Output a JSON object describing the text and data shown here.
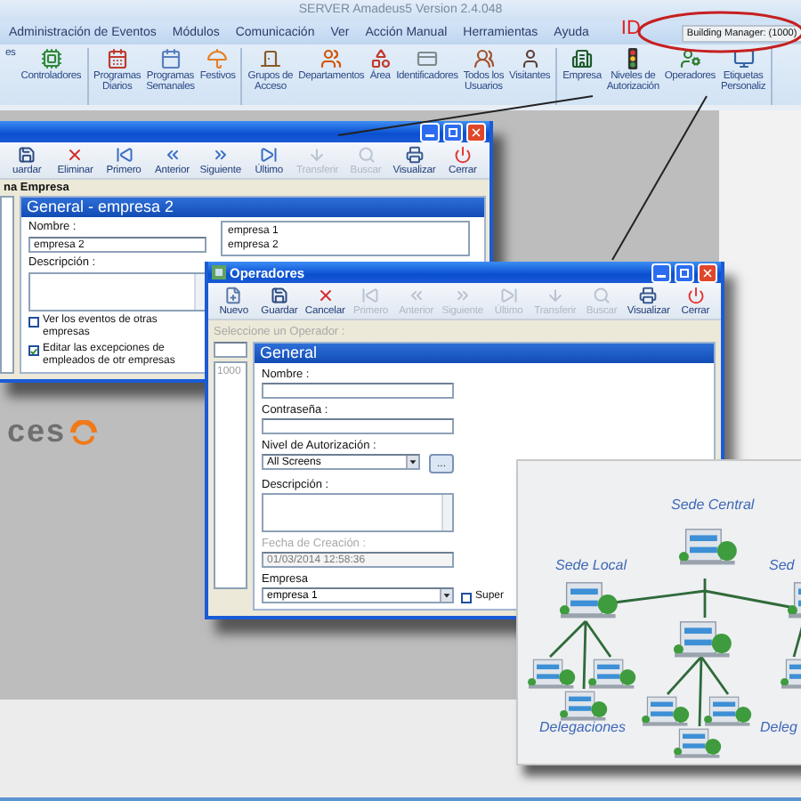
{
  "app": {
    "title": "SERVER Amadeus5 Version 2.4.048"
  },
  "menu": [
    "Administración de Eventos",
    "Módulos",
    "Comunicación",
    "Ver",
    "Acción Manual",
    "Herramientas",
    "Ayuda"
  ],
  "callout": {
    "label": "ID",
    "user": "Building Manager: (1000)"
  },
  "toolbar": [
    {
      "items": [
        {
          "kind": "cut",
          "label": "es"
        },
        {
          "kind": "controllers",
          "label": "Controladores"
        }
      ]
    },
    {
      "items": [
        {
          "kind": "daily",
          "label": "Programas\nDiarios"
        },
        {
          "kind": "weekly",
          "label": "Programas\nSemanales"
        },
        {
          "kind": "holidays",
          "label": "Festivos"
        }
      ]
    },
    {
      "items": [
        {
          "kind": "groups",
          "label": "Grupos de\nAcceso"
        },
        {
          "kind": "departments",
          "label": "Departamentos"
        },
        {
          "kind": "area",
          "label": "Área"
        },
        {
          "kind": "ids",
          "label": "Identificadores"
        },
        {
          "kind": "users",
          "label": "Todos los\nUsuarios"
        },
        {
          "kind": "visitors",
          "label": "Visitantes"
        }
      ]
    },
    {
      "items": [
        {
          "kind": "company",
          "label": "Empresa"
        },
        {
          "kind": "levels",
          "label": "Niveles de\nAutorización"
        },
        {
          "kind": "operators",
          "label": "Operadores"
        },
        {
          "kind": "labels",
          "label": "Etiquetas\nPersonaliz"
        }
      ]
    }
  ],
  "empresa_window": {
    "toolbar": [
      {
        "kind": "save",
        "label": "uardar",
        "disabled": false
      },
      {
        "kind": "delete",
        "label": "Eliminar",
        "disabled": false
      },
      {
        "kind": "first",
        "label": "Primero",
        "disabled": false
      },
      {
        "kind": "previous",
        "label": "Anterior",
        "disabled": false
      },
      {
        "kind": "next",
        "label": "Siguiente",
        "disabled": false
      },
      {
        "kind": "last",
        "label": "Último",
        "disabled": false
      },
      {
        "kind": "transfer",
        "label": "Transferir",
        "disabled": true
      },
      {
        "kind": "search",
        "label": "Buscar",
        "disabled": true
      },
      {
        "kind": "print",
        "label": "Visualizar",
        "disabled": false
      },
      {
        "kind": "close",
        "label": "Cerrar",
        "disabled": false
      }
    ],
    "section_label": "na Empresa",
    "header": "General - empresa 2",
    "name_label": "Nombre :",
    "name_value": "empresa 2",
    "description_label": "Descripción :",
    "checkboxes": [
      {
        "label": "Ver los eventos de otras empresas",
        "checked": false
      },
      {
        "label": "Editar las excepciones de empleados de otr empresas",
        "checked": true
      }
    ],
    "list": [
      "empresa 1",
      "empresa 2"
    ]
  },
  "logo": {
    "text": "ces"
  },
  "operadores_window": {
    "title": "Operadores",
    "toolbar": [
      {
        "kind": "new",
        "label": "Nuevo",
        "disabled": false
      },
      {
        "kind": "save",
        "label": "Guardar",
        "disabled": false
      },
      {
        "kind": "cancel",
        "label": "Cancelar",
        "disabled": false
      },
      {
        "kind": "first",
        "label": "Primero",
        "disabled": true
      },
      {
        "kind": "previous",
        "label": "Anterior",
        "disabled": true
      },
      {
        "kind": "next",
        "label": "Siguiente",
        "disabled": true
      },
      {
        "kind": "last",
        "label": "Último",
        "disabled": true
      },
      {
        "kind": "transfer",
        "label": "Transferir",
        "disabled": true
      },
      {
        "kind": "search",
        "label": "Buscar",
        "disabled": true
      },
      {
        "kind": "print",
        "label": "Visualizar",
        "disabled": false
      },
      {
        "kind": "close",
        "label": "Cerrar",
        "disabled": false
      }
    ],
    "list_label": "Seleccione un Operador :",
    "list": [
      "1000"
    ],
    "header": "General",
    "fields": [
      {
        "kind": "text",
        "label": "Nombre :",
        "disabled": false
      },
      {
        "kind": "text",
        "label": "Contraseña :",
        "disabled": false
      },
      {
        "kind": "select",
        "label": "Nivel de Autorización :",
        "value": "All Screens",
        "button": "...",
        "disabled": false
      },
      {
        "kind": "textarea",
        "label": "Descripción :",
        "disabled": false
      },
      {
        "kind": "text",
        "label": "Fecha de Creación :",
        "value": "01/03/2014 12:58:36",
        "disabled": true
      },
      {
        "kind": "select",
        "label": "Empresa",
        "value": "empresa 1",
        "disabled": false
      }
    ],
    "checkbox": {
      "label": "Super",
      "checked": false
    }
  },
  "diagram": {
    "labels": [
      "Sede Central",
      "Sede Local",
      "Sed",
      "Delegaciones",
      "Deleg"
    ]
  }
}
